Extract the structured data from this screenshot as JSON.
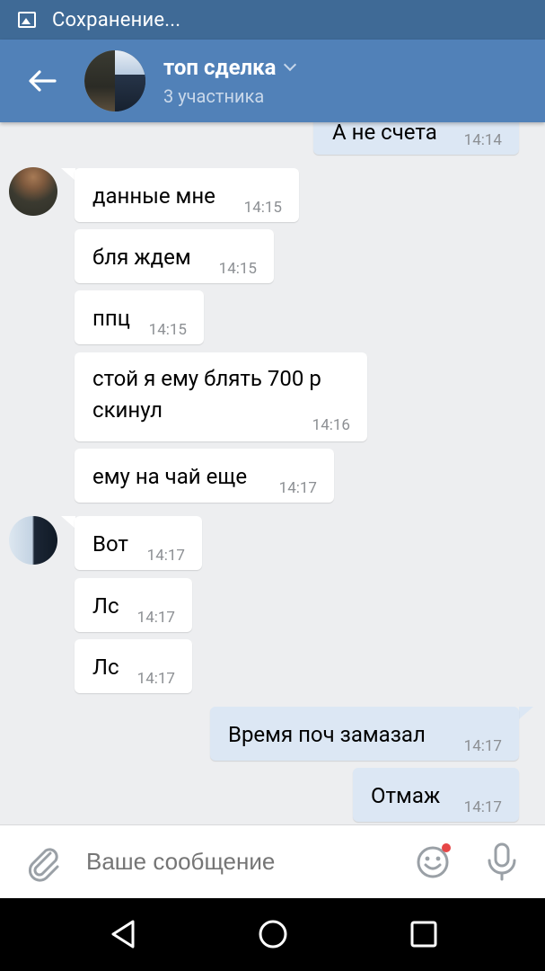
{
  "status_bar": {
    "text": "Сохранение..."
  },
  "header": {
    "title": "топ сделка",
    "subtitle": "3 участника"
  },
  "messages": [
    {
      "dir": "out",
      "text": "А не счета",
      "time": "14:14"
    },
    {
      "dir": "in",
      "text": "данные мне",
      "time": "14:15"
    },
    {
      "dir": "in",
      "text": "бля ждем",
      "time": "14:15"
    },
    {
      "dir": "in",
      "text": "ппц",
      "time": "14:15"
    },
    {
      "dir": "in",
      "text": "стой я ему блять 700 р скинул",
      "time": "14:16"
    },
    {
      "dir": "in",
      "text": "ему на чай еще",
      "time": "14:17"
    },
    {
      "dir": "in",
      "text": "Вот",
      "time": "14:17"
    },
    {
      "dir": "in",
      "text": "Лс",
      "time": "14:17"
    },
    {
      "dir": "in",
      "text": "Лс",
      "time": "14:17"
    },
    {
      "dir": "out",
      "text": "Время поч замазал",
      "time": "14:17"
    },
    {
      "dir": "out",
      "text": "Отмаж",
      "time": "14:17"
    }
  ],
  "composer": {
    "placeholder": "Ваше сообщение"
  },
  "colors": {
    "header": "#5181b8",
    "status_bar": "#3f6a96",
    "out_bubble": "#dce7f4",
    "background": "#edeef0"
  },
  "icons": [
    "image-icon",
    "back-arrow-icon",
    "chevron-down-icon",
    "paperclip-icon",
    "emoji-icon",
    "microphone-icon",
    "nav-back-icon",
    "nav-home-icon",
    "nav-recents-icon"
  ]
}
